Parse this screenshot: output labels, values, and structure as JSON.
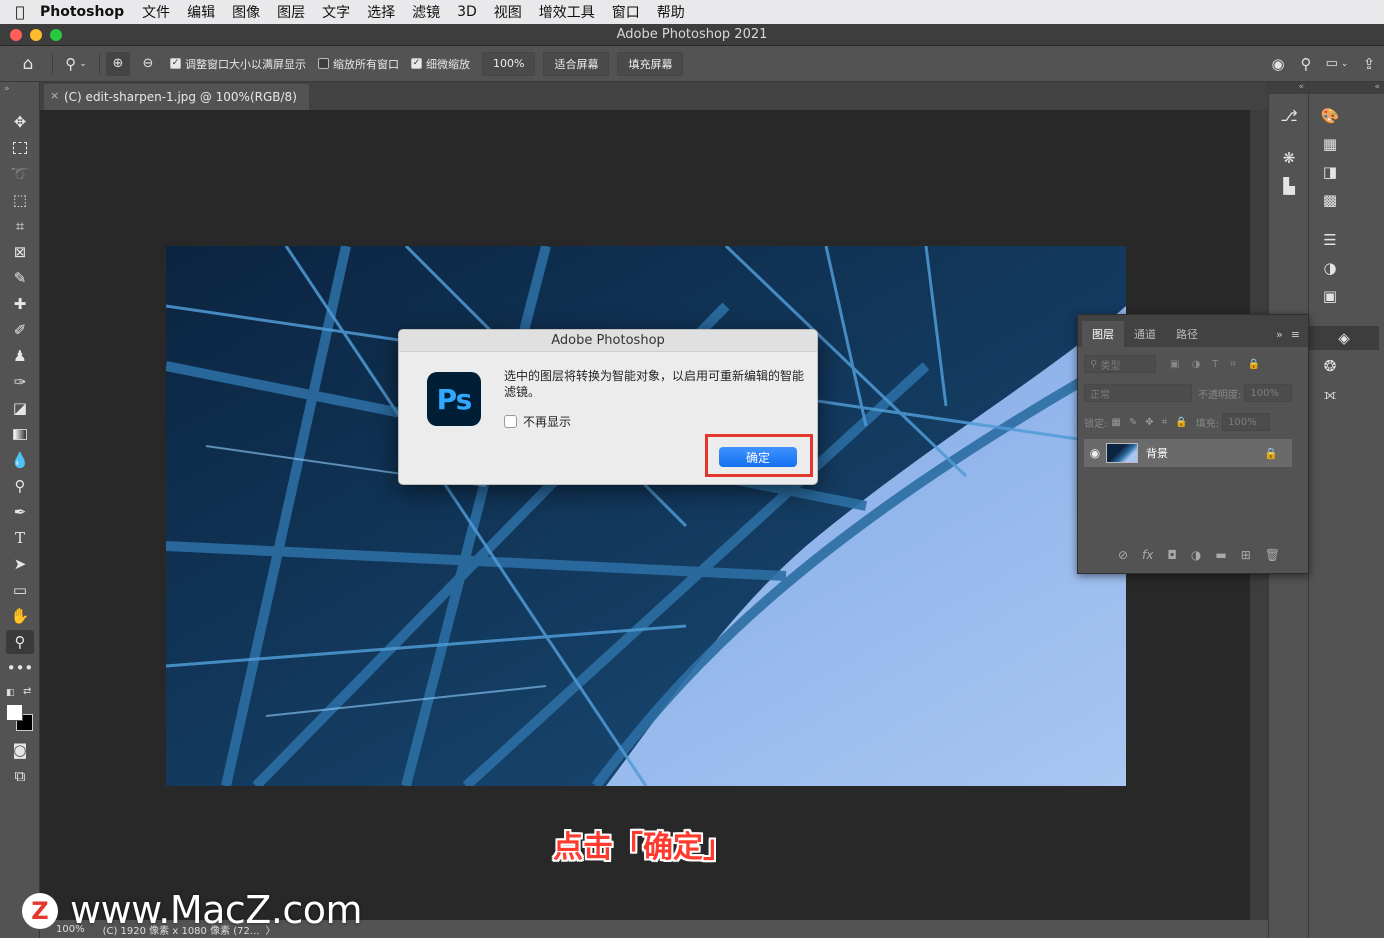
{
  "menubar": {
    "app_name": "Photoshop",
    "items": [
      "文件",
      "编辑",
      "图像",
      "图层",
      "文字",
      "选择",
      "滤镜",
      "3D",
      "视图",
      "增效工具",
      "窗口",
      "帮助"
    ]
  },
  "window": {
    "title": "Adobe Photoshop 2021"
  },
  "options": {
    "resize_windows": {
      "label": "调整窗口大小以满屏显示",
      "checked": true
    },
    "zoom_all": {
      "label": "缩放所有窗口",
      "checked": false
    },
    "scrubby_zoom": {
      "label": "细微缩放",
      "checked": true
    },
    "zoom_value": "100%",
    "fit_screen": "适合屏幕",
    "fill_screen": "填充屏幕"
  },
  "document": {
    "tab_title": "(C) edit-sharpen-1.jpg @ 100%(RGB/8)",
    "close_glyph": "×"
  },
  "status": {
    "zoom": "100%",
    "info": "(C) 1920 像素 x 1080 像素 (72...",
    "arrow": "〉"
  },
  "layers_panel": {
    "tabs": [
      "图层",
      "通道",
      "路径"
    ],
    "filter_label": "类型",
    "blend_mode": "正常",
    "opacity_label": "不透明度:",
    "opacity_value": "100%",
    "lock_label": "锁定:",
    "fill_label": "填充:",
    "fill_value": "100%",
    "layer_name": "背景"
  },
  "dialog": {
    "title": "Adobe Photoshop",
    "logo_text": "Ps",
    "message": "选中的图层将转换为智能对象，以启用可重新编辑的智能滤镜。",
    "dont_show": "不再显示",
    "ok": "确定"
  },
  "annotation": {
    "text": "点击「确定」"
  },
  "watermark": {
    "logo": "Z",
    "text": "www.MacZ.com"
  },
  "colors": {
    "ui_dark": "#535353",
    "canvas": "#282828",
    "ok_blue": "#1470ef",
    "highlight_red": "#e3362c",
    "ps_navy": "#001e36",
    "ps_blue": "#31a8ff"
  }
}
